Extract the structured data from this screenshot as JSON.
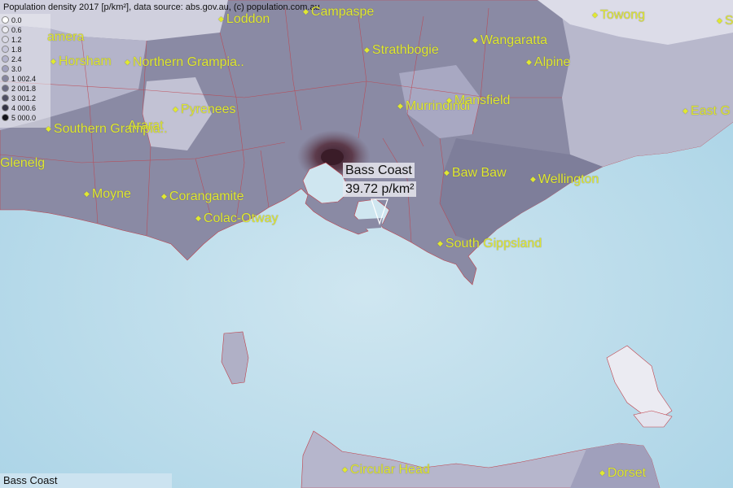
{
  "header": {
    "text": "Population density 2017 [p/km²], data source: abs.gov.au, (c) population.com.au"
  },
  "legend": {
    "items": [
      {
        "label": "0.0",
        "color": "#ffffff"
      },
      {
        "label": "0.6",
        "color": "#ebebf2"
      },
      {
        "label": "1.2",
        "color": "#d9d9e6"
      },
      {
        "label": "1.8",
        "color": "#c6c6da"
      },
      {
        "label": "2.4",
        "color": "#b3b3cc"
      },
      {
        "label": "3.0",
        "color": "#a0a0bd"
      },
      {
        "label": "1 002.4",
        "color": "#85859f"
      },
      {
        "label": "2 001.8",
        "color": "#6a6a82"
      },
      {
        "label": "3 001.2",
        "color": "#4f4f63"
      },
      {
        "label": "4 000.6",
        "color": "#343445"
      },
      {
        "label": "5 000.0",
        "color": "#121218"
      }
    ]
  },
  "places": [
    {
      "name": "Loddon",
      "dot": true
    },
    {
      "name": "Campaspe",
      "dot": true
    },
    {
      "name": "Towong",
      "dot": true
    },
    {
      "name": "Sn",
      "dot": true
    },
    {
      "name": "amera",
      "dot": false
    },
    {
      "name": "Horsham",
      "dot": true
    },
    {
      "name": "Northern Grampia..",
      "dot": true
    },
    {
      "name": "Strathbogie",
      "dot": true
    },
    {
      "name": "Wangaratta",
      "dot": true
    },
    {
      "name": "Alpine",
      "dot": true
    },
    {
      "name": "Pyrenees",
      "dot": true
    },
    {
      "name": "Murrindindi",
      "dot": true
    },
    {
      "name": "Mansfield",
      "dot": true
    },
    {
      "name": "East G",
      "dot": true
    },
    {
      "name": "Southern Grampia..",
      "dot": true
    },
    {
      "name": "Ararat",
      "dot": false
    },
    {
      "name": "Glenelg",
      "dot": false
    },
    {
      "name": "Baw Baw",
      "dot": true
    },
    {
      "name": "Wellington",
      "dot": true
    },
    {
      "name": "Moyne",
      "dot": true
    },
    {
      "name": "Corangamite",
      "dot": true
    },
    {
      "name": "Colac-Otway",
      "dot": true
    },
    {
      "name": "South Gippsland",
      "dot": true
    },
    {
      "name": "Circular Head",
      "dot": true
    },
    {
      "name": "Dorset",
      "dot": true
    }
  ],
  "callout": {
    "name": "Bass Coast",
    "value": "39.72 p/km²"
  },
  "footer": {
    "label": "Bass Coast"
  },
  "colors": {
    "sea": "#cfe6f0",
    "land": "#8a8aa4",
    "border": "#c0404a",
    "label": "#e0e832"
  }
}
